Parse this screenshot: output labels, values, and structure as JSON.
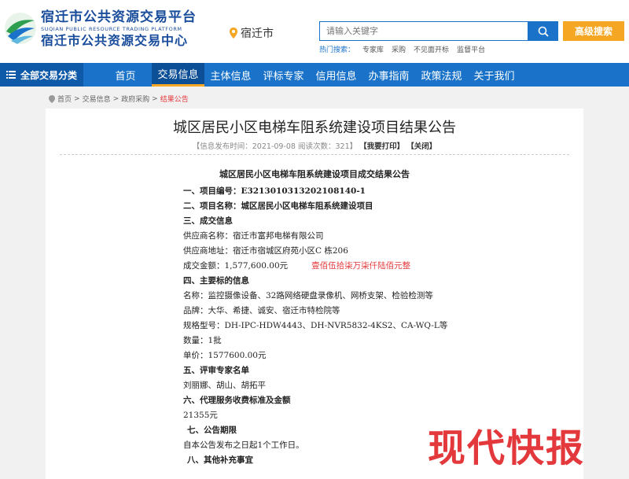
{
  "header": {
    "logo_cn1": "宿迁市公共资源交易平台",
    "logo_en": "SUQIAN PUBLIC RESOURCE TRADING PLATFORM",
    "logo_cn2": "宿迁市公共资源交易中心",
    "location": "宿迁市",
    "search_placeholder": "请输入关键字",
    "adv_search": "高级搜索",
    "hot_label": "热门搜索：",
    "hot_items": [
      "专家库",
      "采购",
      "不见面开标",
      "监督平台"
    ]
  },
  "nav": {
    "category": "全部交易分类",
    "items": [
      "首页",
      "交易信息",
      "主体信息",
      "评标专家",
      "信用信息",
      "办事指南",
      "政策法规",
      "关于我们"
    ]
  },
  "breadcrumb": [
    "首页",
    "交易信息",
    "政府采购",
    "结果公告"
  ],
  "article": {
    "title": "城区居民小区电梯车阻系统建设项目结果公告",
    "meta_prefix": "【信息发布时间：2021-09-08  阅读次数：321】",
    "print": "【我要打印】",
    "close": "【关闭】"
  },
  "doc": {
    "title": "城区居民小区电梯车阻系统建设项目成交结果公告",
    "l1": "一、项目编号：E3213010313202108140-1",
    "l2": "二、项目名称：城区居民小区电梯车阻系统建设项目",
    "l3": "三、成交信息",
    "l4": "供应商名称：宿迁市富邦电梯有限公司",
    "l5": "供应商地址：宿迁市宿城区府苑小区C 栋206",
    "l6": "成交金额：1,577,600.00元",
    "l6_red": "壹佰伍拾柒万柒仟陆佰元整",
    "l7": "四、主要标的信息",
    "l8": "名称：监控摄像设备、32路网络硬盘录像机、网桥支架、检验检测等",
    "l9": "品牌：大华、希捷、诚安、宿迁市特检院等",
    "l10": "规格型号：DH-IPC-HDW4443、DH-NVR5832-4KS2、CA-WQ-L等",
    "l11": "数量：1批",
    "l12": "单价：1577600.00元",
    "l13": "五、评审专家名单",
    "l14": "刘丽娜、胡山、胡拓平",
    "l15": "六、代理服务收费标准及金额",
    "l16": "21355元",
    "l17": "七、公告期限",
    "l18": "自本公告发布之日起1个工作日。",
    "l19": "八、其他补充事宜"
  },
  "watermark": "现代快报"
}
